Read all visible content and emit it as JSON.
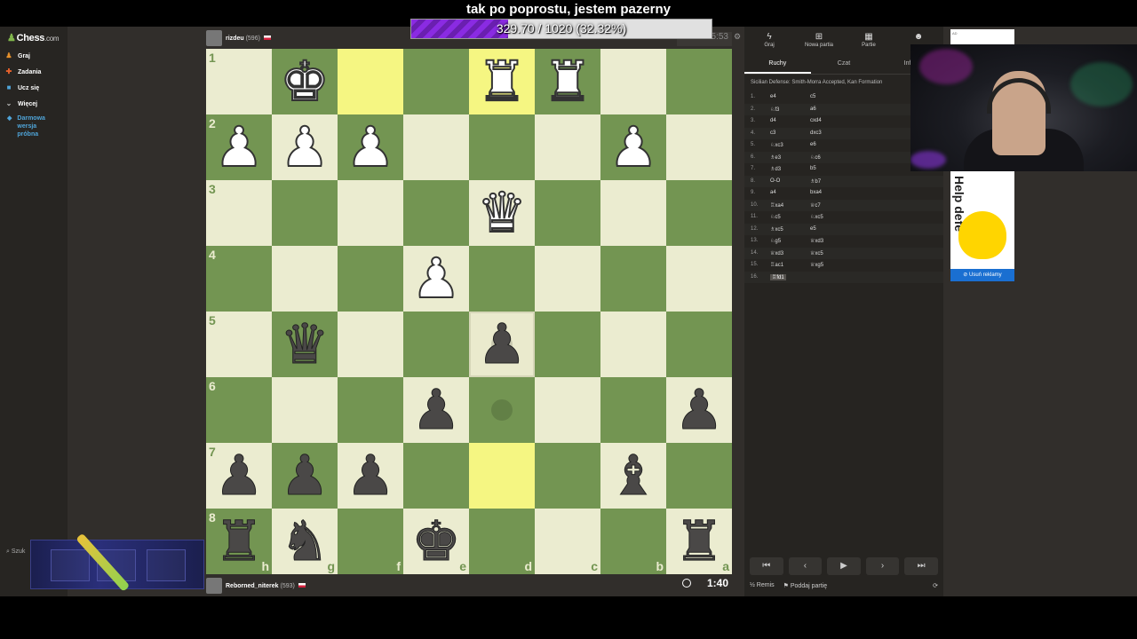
{
  "caption": "tak po poprostu, jestem pazerny",
  "progress": {
    "text": "329.70 / 1020 (32.32%)",
    "fraction": 0.3232
  },
  "brand": {
    "name": "Chess",
    "suffix": ".com"
  },
  "sidebar": {
    "items": [
      {
        "label": "Graj",
        "icon": "pawn-icon",
        "color": "#e6912c"
      },
      {
        "label": "Zadania",
        "icon": "puzzle-icon",
        "color": "#e6612c"
      },
      {
        "label": "Ucz się",
        "icon": "learn-icon",
        "color": "#4fa4d8"
      },
      {
        "label": "Więcej",
        "icon": "chevron-down-icon",
        "color": "#bbbbbb"
      }
    ],
    "trial_lines": [
      "Darmowa",
      "wersja",
      "próbna"
    ],
    "search_label": "Szuk"
  },
  "top_player": {
    "name": "rizdeu",
    "rating": "(596)",
    "clock": "5:53"
  },
  "bottom_player": {
    "name": "Reborned_niterek",
    "rating": "(593)",
    "clock": "1:40"
  },
  "board": {
    "ranks": [
      "1",
      "2",
      "3",
      "4",
      "5",
      "6",
      "7",
      "8"
    ],
    "files": [
      "h",
      "g",
      "f",
      "e",
      "d",
      "c",
      "b",
      "a"
    ],
    "pieces": [
      {
        "r": 0,
        "c": 1,
        "t": "♚",
        "side": "w"
      },
      {
        "r": 0,
        "c": 4,
        "t": "♜",
        "side": "w"
      },
      {
        "r": 0,
        "c": 5,
        "t": "♜",
        "side": "w"
      },
      {
        "r": 1,
        "c": 0,
        "t": "♟",
        "side": "w"
      },
      {
        "r": 1,
        "c": 1,
        "t": "♟",
        "side": "w"
      },
      {
        "r": 1,
        "c": 2,
        "t": "♟",
        "side": "w"
      },
      {
        "r": 1,
        "c": 6,
        "t": "♟",
        "side": "w"
      },
      {
        "r": 2,
        "c": 4,
        "t": "♛",
        "side": "w"
      },
      {
        "r": 3,
        "c": 3,
        "t": "♟",
        "side": "w"
      },
      {
        "r": 4,
        "c": 1,
        "t": "♛",
        "side": "b"
      },
      {
        "r": 4,
        "c": 4,
        "t": "♟",
        "side": "b"
      },
      {
        "r": 5,
        "c": 3,
        "t": "♟",
        "side": "b"
      },
      {
        "r": 5,
        "c": 7,
        "t": "♟",
        "side": "b"
      },
      {
        "r": 6,
        "c": 0,
        "t": "♟",
        "side": "b"
      },
      {
        "r": 6,
        "c": 1,
        "t": "♟",
        "side": "b"
      },
      {
        "r": 6,
        "c": 2,
        "t": "♟",
        "side": "b"
      },
      {
        "r": 6,
        "c": 6,
        "t": "♝",
        "side": "b"
      },
      {
        "r": 7,
        "c": 0,
        "t": "♜",
        "side": "b"
      },
      {
        "r": 7,
        "c": 1,
        "t": "♞",
        "side": "b"
      },
      {
        "r": 7,
        "c": 3,
        "t": "♚",
        "side": "b"
      },
      {
        "r": 7,
        "c": 7,
        "t": "♜",
        "side": "b"
      }
    ],
    "highlights": [
      [
        0,
        2
      ],
      [
        0,
        4
      ],
      [
        6,
        4
      ]
    ],
    "selected": [
      4,
      4
    ],
    "dots": [
      [
        4,
        4
      ],
      [
        5,
        4
      ]
    ]
  },
  "panel": {
    "tabs": [
      {
        "label": "Graj",
        "icon": "lightning-icon"
      },
      {
        "label": "Nowa partia",
        "icon": "plus-icon"
      },
      {
        "label": "Partie",
        "icon": "board-icon"
      },
      {
        "label": "",
        "icon": "friends-icon"
      }
    ],
    "subtabs": [
      "Ruchy",
      "Czat",
      "Infor"
    ],
    "opening": "Sicilian Defense: Smith-Morra Accepted, Kan Formation",
    "moves": [
      {
        "n": "1.",
        "w": "e4",
        "b": "c5"
      },
      {
        "n": "2.",
        "w": "♘f3",
        "b": "a6"
      },
      {
        "n": "3.",
        "w": "d4",
        "b": "cxd4"
      },
      {
        "n": "4.",
        "w": "c3",
        "b": "dxc3"
      },
      {
        "n": "5.",
        "w": "♘xc3",
        "b": "e6"
      },
      {
        "n": "6.",
        "w": "♗e3",
        "b": "♘c6"
      },
      {
        "n": "7.",
        "w": "♗d3",
        "b": "b5"
      },
      {
        "n": "8.",
        "w": "O-O",
        "b": "♗b7"
      },
      {
        "n": "9.",
        "w": "a4",
        "b": "bxa4"
      },
      {
        "n": "10.",
        "w": "♖xa4",
        "b": "♕c7"
      },
      {
        "n": "11.",
        "w": "♘c5",
        "b": "♘xc5"
      },
      {
        "n": "12.",
        "w": "♗xc5",
        "b": "e5"
      },
      {
        "n": "13.",
        "w": "♘g5",
        "b": "♕xd3"
      },
      {
        "n": "14.",
        "w": "♕xd3",
        "b": "♕xc5"
      },
      {
        "n": "15.",
        "w": "♖ac1",
        "b": "♕xg5"
      },
      {
        "n": "16.",
        "w": "♖fd1",
        "b": ""
      }
    ],
    "nav": [
      "⏮",
      "‹",
      "▶",
      "›",
      "⏭"
    ],
    "draw_label": "Remis",
    "resign_label": "Poddaj partię"
  },
  "ad": {
    "tag": "AD",
    "text": "Help defe",
    "remove_label": "Usuń reklamy"
  }
}
